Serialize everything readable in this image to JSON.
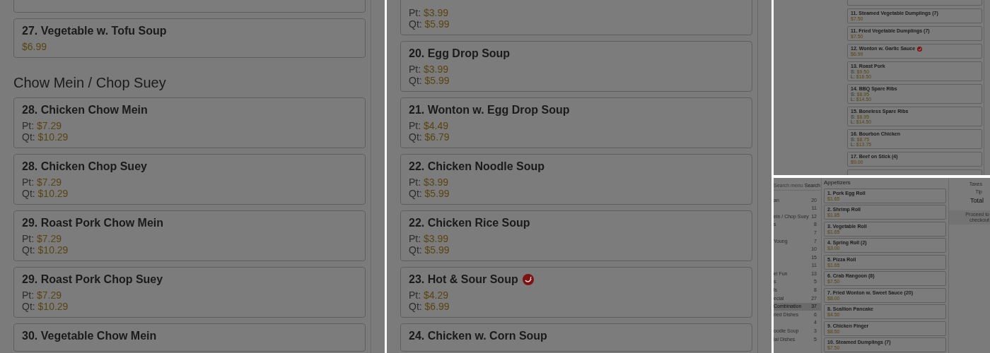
{
  "panels": [
    {
      "kind": "large",
      "blocks": [
        {
          "kind": "item"
        },
        {
          "kind": "item",
          "name": "27. Vegetable w. Tofu Soup",
          "spicy": false,
          "prices": [
            {
              "value": "$6.99"
            }
          ]
        },
        {
          "kind": "heading",
          "name": "Chow Mein / Chop Suey"
        },
        {
          "kind": "item",
          "name": "28. Chicken Chow Mein",
          "spicy": false,
          "prices": [
            {
              "label": "Pt:",
              "value": "$7.29"
            },
            {
              "label": "Qt:",
              "value": "$10.29"
            }
          ]
        },
        {
          "kind": "item",
          "name": "28. Chicken Chop Suey",
          "spicy": false,
          "prices": [
            {
              "label": "Pt:",
              "value": "$7.29"
            },
            {
              "label": "Qt:",
              "value": "$10.29"
            }
          ]
        },
        {
          "kind": "item",
          "name": "29. Roast Pork Chow Mein",
          "spicy": false,
          "prices": [
            {
              "label": "Pt:",
              "value": "$7.29"
            },
            {
              "label": "Qt:",
              "value": "$10.29"
            }
          ]
        },
        {
          "kind": "item",
          "name": "29. Roast Pork Chop Suey",
          "spicy": false,
          "prices": [
            {
              "label": "Pt:",
              "value": "$7.29"
            },
            {
              "label": "Qt:",
              "value": "$10.29"
            }
          ]
        },
        {
          "kind": "item",
          "name": "30. Vegetable Chow Mein",
          "spicy": false
        }
      ]
    },
    {
      "kind": "large",
      "blocks": [
        {
          "kind": "item",
          "prices": [
            {
              "label": "Pt:",
              "value": "$3.99"
            },
            {
              "label": "Qt:",
              "value": "$5.99"
            }
          ]
        },
        {
          "kind": "item",
          "name": "20. Egg Drop Soup",
          "spicy": false,
          "prices": [
            {
              "label": "Pt:",
              "value": "$3.99"
            },
            {
              "label": "Qt:",
              "value": "$5.99"
            }
          ]
        },
        {
          "kind": "item",
          "name": "21. Wonton w. Egg Drop Soup",
          "spicy": false,
          "prices": [
            {
              "label": "Pt:",
              "value": "$4.49"
            },
            {
              "label": "Qt:",
              "value": "$6.79"
            }
          ]
        },
        {
          "kind": "item",
          "name": "22. Chicken Noodle Soup",
          "spicy": false,
          "prices": [
            {
              "label": "Pt:",
              "value": "$3.99"
            },
            {
              "label": "Qt:",
              "value": "$5.99"
            }
          ]
        },
        {
          "kind": "item",
          "name": "22. Chicken Rice Soup",
          "spicy": false,
          "prices": [
            {
              "label": "Pt:",
              "value": "$3.99"
            },
            {
              "label": "Qt:",
              "value": "$5.99"
            }
          ]
        },
        {
          "kind": "item",
          "name": "23. Hot & Sour Soup",
          "spicy": true,
          "prices": [
            {
              "label": "Pt:",
              "value": "$4.29"
            },
            {
              "label": "Qt:",
              "value": "$6.99"
            }
          ]
        },
        {
          "kind": "item",
          "name": "24. Chicken w. Corn Soup",
          "spicy": false
        }
      ]
    },
    {
      "kind": "small",
      "blocks": [
        {
          "kind": "item"
        },
        {
          "kind": "item",
          "name": "11. Steamed Vegetable Dumplings (7)",
          "spicy": false,
          "prices": [
            {
              "value": "$7.50"
            }
          ]
        },
        {
          "kind": "item",
          "name": "11. Fried Vegetable Dumplings (7)",
          "spicy": false,
          "prices": [
            {
              "value": "$7.50"
            }
          ]
        },
        {
          "kind": "item",
          "name": "12. Wonton w. Garlic Sauce",
          "spicy": true,
          "prices": [
            {
              "value": "$6.99"
            }
          ]
        },
        {
          "kind": "item",
          "name": "13. Roast Pork",
          "spicy": false,
          "prices": [
            {
              "label": "S:",
              "value": "$9.50"
            },
            {
              "label": "L:",
              "value": "$16.50"
            }
          ]
        },
        {
          "kind": "item",
          "name": "14. BBQ Spare Ribs",
          "spicy": false,
          "prices": [
            {
              "label": "S:",
              "value": "$8.95"
            },
            {
              "label": "L:",
              "value": "$14.50"
            }
          ]
        },
        {
          "kind": "item",
          "name": "15. Boneless Spare Ribs",
          "spicy": false,
          "prices": [
            {
              "label": "S:",
              "value": "$8.95"
            },
            {
              "label": "L:",
              "value": "$14.50"
            }
          ]
        },
        {
          "kind": "item",
          "name": "16. Bourbon Chicken",
          "spicy": false,
          "prices": [
            {
              "label": "S:",
              "value": "$8.75"
            },
            {
              "label": "L:",
              "value": "$13.75"
            }
          ]
        },
        {
          "kind": "item",
          "name": "17. Beef on Stick (4)",
          "spicy": false,
          "prices": [
            {
              "value": "$9.00"
            }
          ]
        },
        {
          "kind": "item"
        }
      ]
    },
    {
      "kind": "shop",
      "search": {
        "placeholder": "Search menu",
        "button": "Search"
      },
      "categories": [
        {
          "name": "an",
          "count": "20",
          "selected": false
        },
        {
          "count": "11",
          "selected": false
        },
        {
          "name": "ein / Chop Suey",
          "count": "12",
          "selected": false
        },
        {
          "name": "s",
          "count": "8",
          "selected": false
        },
        {
          "count": "7",
          "selected": false
        },
        {
          "name": "Young",
          "count": "7",
          "selected": false
        },
        {
          "count": "10",
          "selected": false
        },
        {
          "count": "15",
          "selected": false
        },
        {
          "count": "11",
          "selected": false
        },
        {
          "name": "ei Fun",
          "count": "13",
          "selected": false
        },
        {
          "name": "s",
          "count": "5",
          "selected": false
        },
        {
          "name": "ls",
          "count": "8",
          "selected": false
        },
        {
          "name": "ecial",
          "count": "27",
          "selected": false
        },
        {
          "name": "Combination",
          "count": "37",
          "selected": true
        },
        {
          "name": "ried Dishes",
          "count": "6",
          "selected": false
        },
        {
          "count": "4",
          "selected": false
        },
        {
          "name": "oodle Soup",
          "count": "3",
          "selected": false
        },
        {
          "name": "ial Dishes",
          "count": "5",
          "selected": false
        }
      ],
      "section": "Appetizers",
      "blocks": [
        {
          "kind": "item",
          "name": "1. Pork Egg Roll",
          "spicy": false,
          "prices": [
            {
              "value": "$1.65"
            }
          ]
        },
        {
          "kind": "item",
          "name": "2. Shrimp Roll",
          "spicy": false,
          "prices": [
            {
              "value": "$1.85"
            }
          ]
        },
        {
          "kind": "item",
          "name": "3. Vegetable Roll",
          "spicy": false,
          "prices": [
            {
              "value": "$1.65"
            }
          ]
        },
        {
          "kind": "item",
          "name": "4. Spring Roll (2)",
          "spicy": false,
          "prices": [
            {
              "value": "$3.00"
            }
          ]
        },
        {
          "kind": "item",
          "name": "5. Pizza Roll",
          "spicy": false,
          "prices": [
            {
              "value": "$1.65"
            }
          ]
        },
        {
          "kind": "item",
          "name": "6. Crab Rangoon (8)",
          "spicy": false,
          "prices": [
            {
              "value": "$7.50"
            }
          ]
        },
        {
          "kind": "item",
          "name": "7. Fried Wonton w. Sweet Sauce (20)",
          "spicy": false,
          "prices": [
            {
              "value": "$8.00"
            }
          ]
        },
        {
          "kind": "item",
          "name": "8. Scallion Pancake",
          "spicy": false,
          "prices": [
            {
              "value": "$4.50"
            }
          ]
        },
        {
          "kind": "item",
          "name": "9. Chicken Finger",
          "spicy": false,
          "prices": [
            {
              "value": "$8.50"
            }
          ]
        },
        {
          "kind": "item",
          "name": "10. Steamed Dumplings (7)",
          "spicy": false,
          "prices": [
            {
              "value": "$7.50"
            }
          ]
        }
      ],
      "summary": [
        "Taxes",
        "Tip",
        "Total"
      ],
      "checkout": "Proceed to checkout"
    }
  ]
}
